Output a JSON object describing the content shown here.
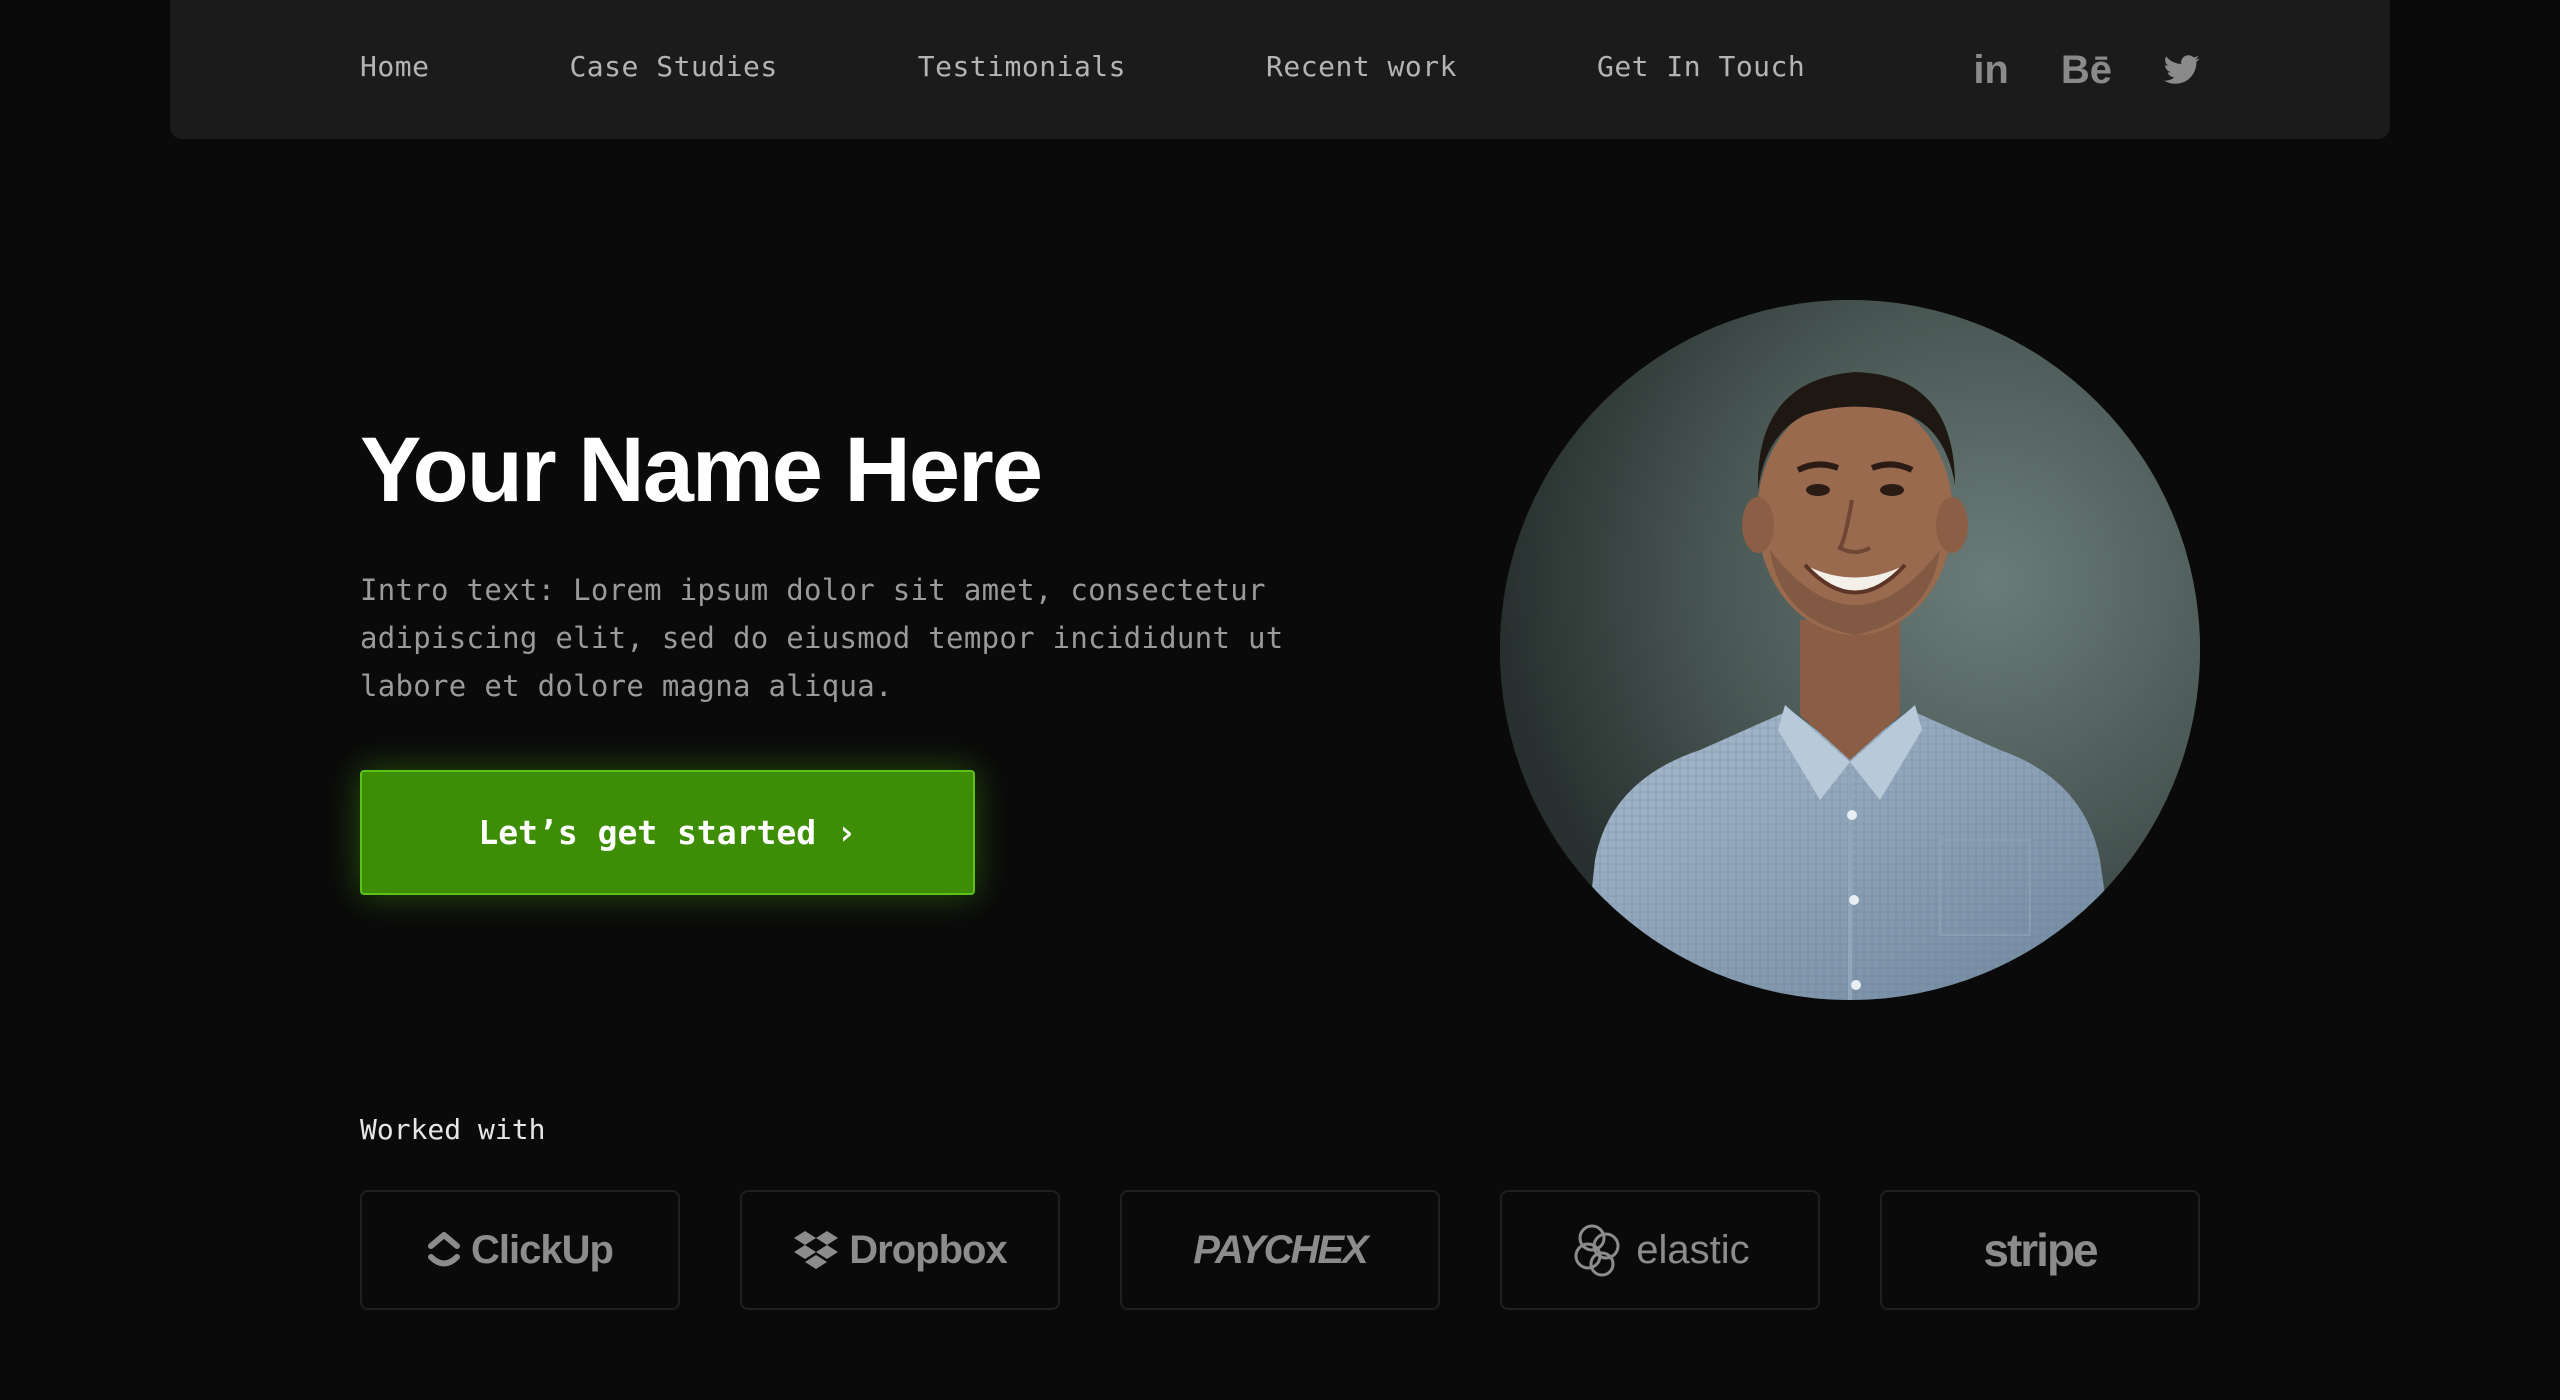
{
  "nav": {
    "links": [
      "Home",
      "Case Studies",
      "Testimonials",
      "Recent work",
      "Get In Touch"
    ],
    "social": [
      {
        "name": "linkedin-icon",
        "text": "in"
      },
      {
        "name": "behance-icon",
        "text": "Bē"
      },
      {
        "name": "twitter-icon",
        "text": ""
      }
    ]
  },
  "hero": {
    "title": "Your Name Here",
    "intro": "Intro text: Lorem ipsum dolor sit amet, consectetur adipiscing elit, sed do eiusmod tempor incididunt ut labore et dolore magna aliqua.",
    "cta_label": "Let’s get started",
    "cta_icon": "›"
  },
  "worked_with": {
    "label": "Worked with",
    "logos": [
      "ClickUp",
      "Dropbox",
      "PAYCHEX",
      "elastic",
      "stripe"
    ]
  },
  "colors": {
    "background": "#0a0a0a",
    "nav_background": "#1b1b1b",
    "accent_green": "#3e8e05",
    "logo_gray": "#8c8c8c"
  }
}
